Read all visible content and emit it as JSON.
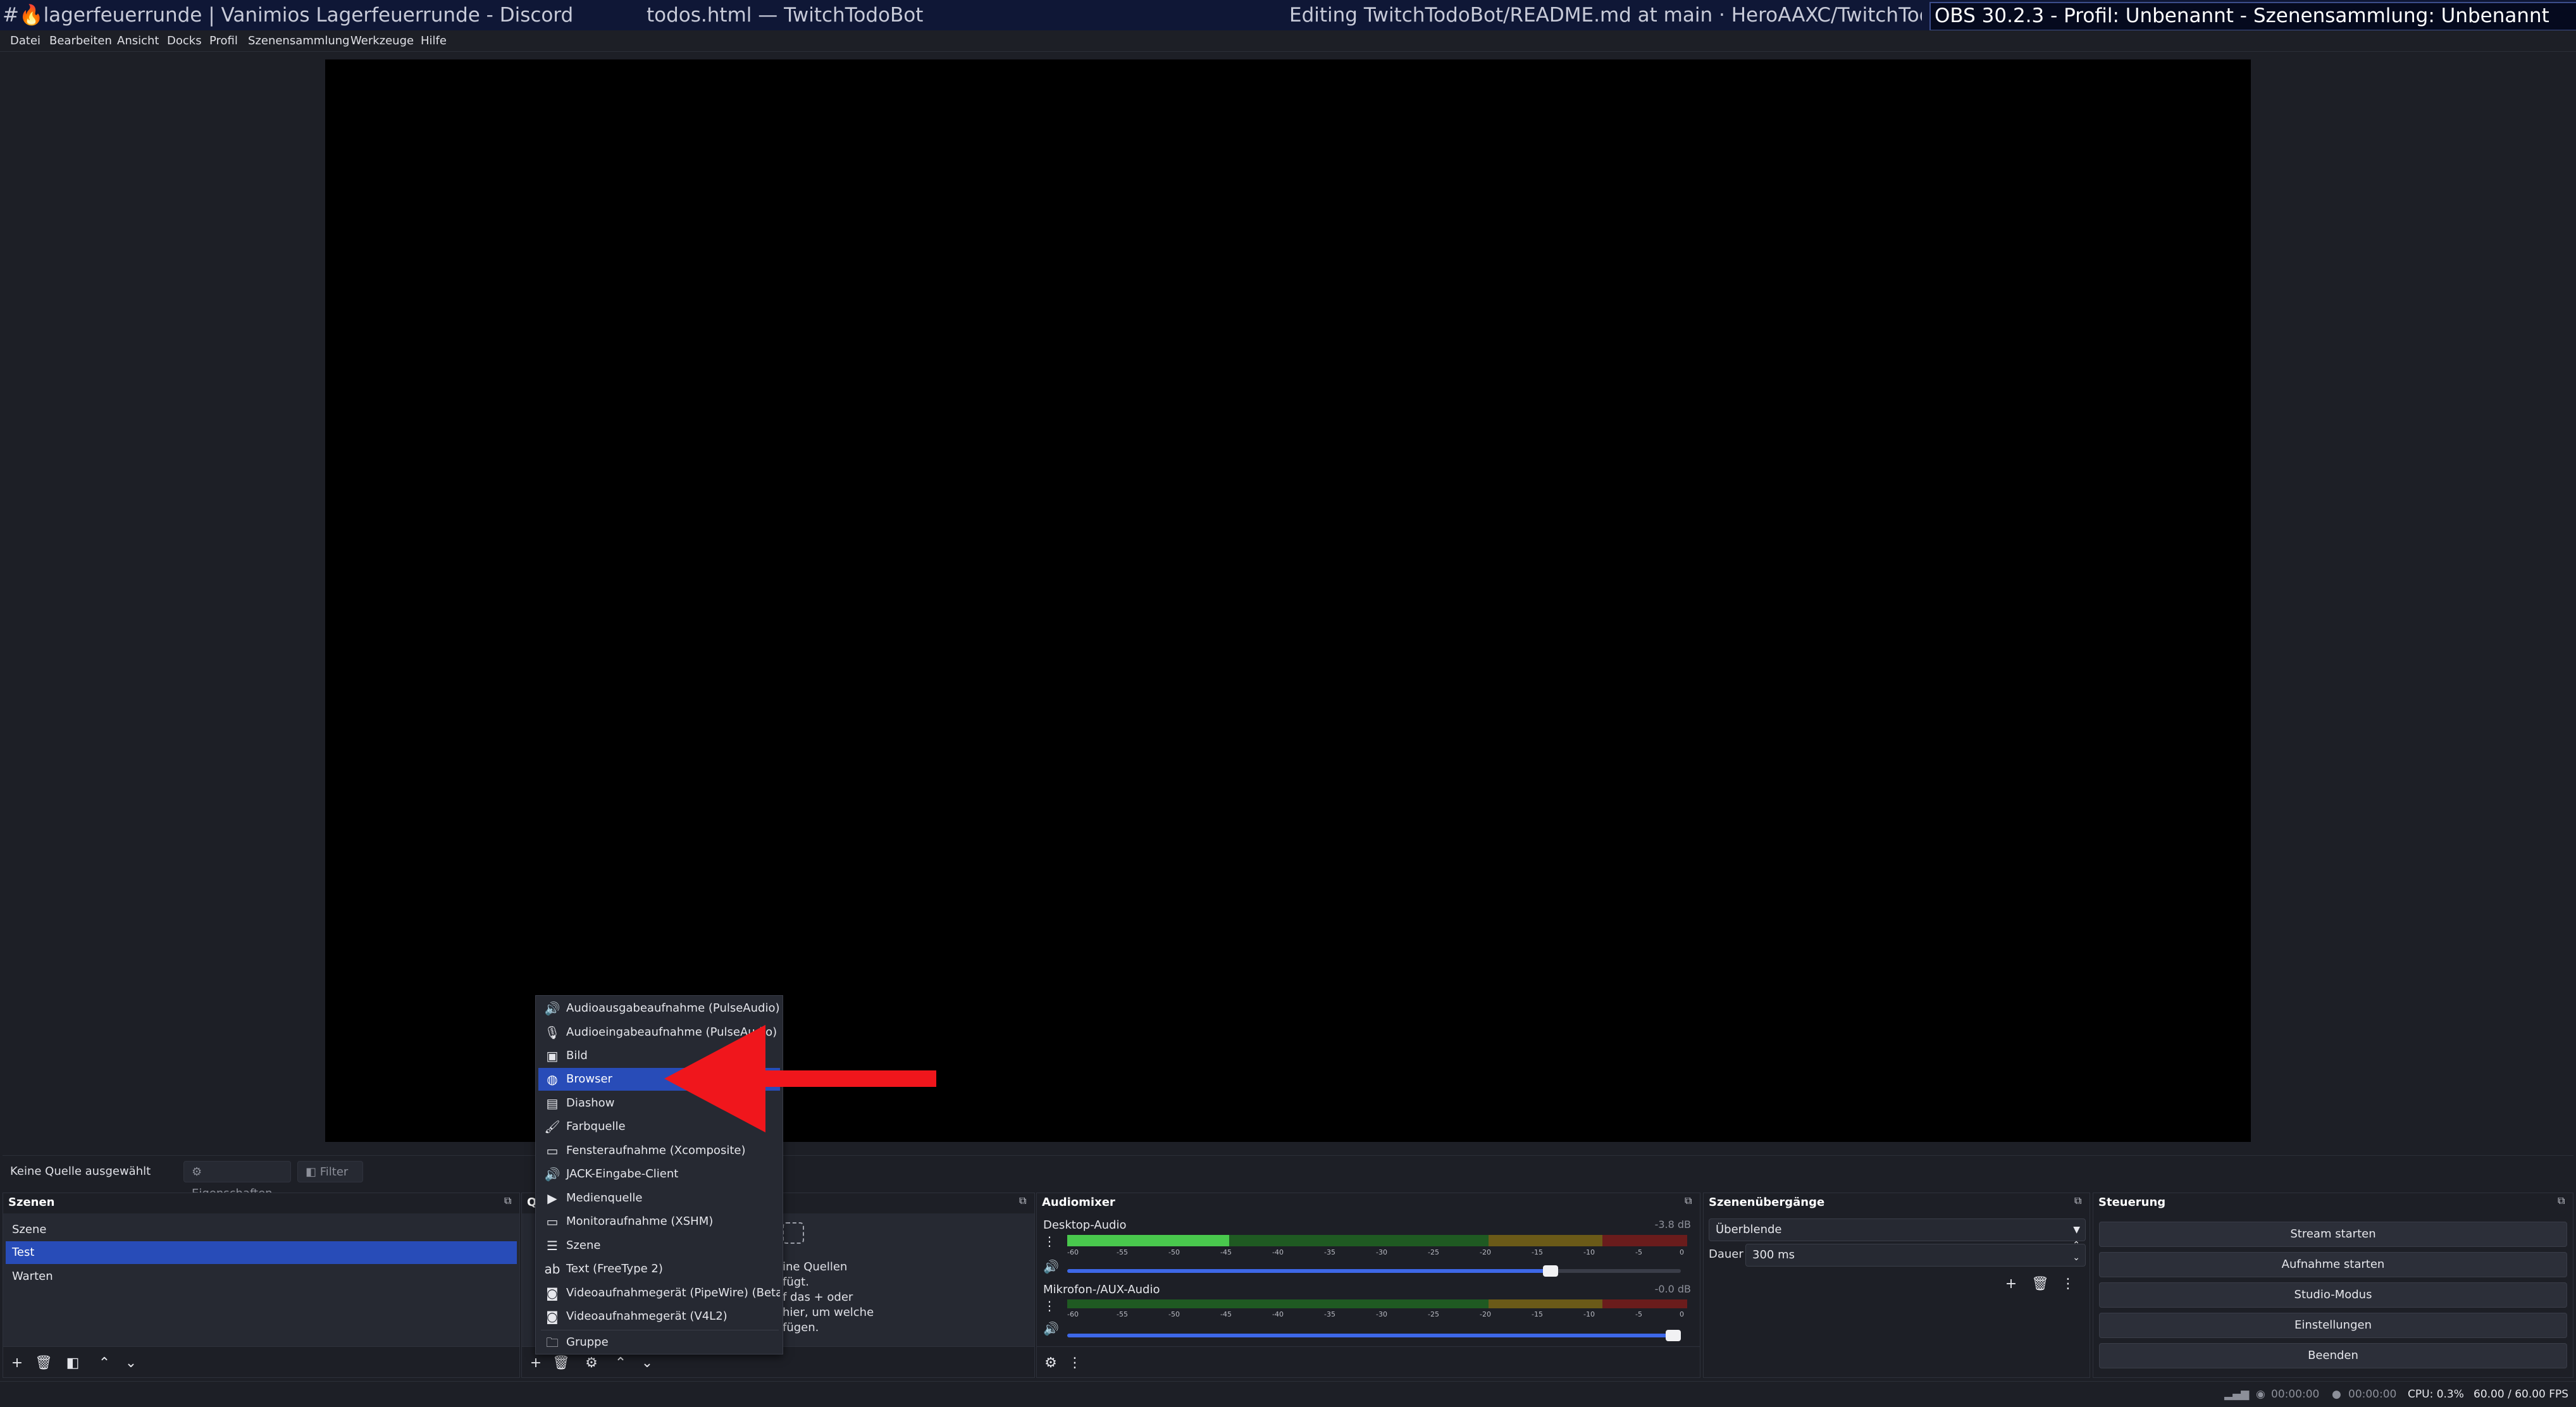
{
  "taskbar": {
    "windows": [
      {
        "title": "#🔥lagerfeuerrunde | Vanimios Lagerfeuerrunde - Discord"
      },
      {
        "title": "todos.html — TwitchTodoBot"
      },
      {
        "title": "Editing TwitchTodoBot/README.md at main · HeroAAXC/TwitchTodoBo..."
      },
      {
        "title": "OBS 30.2.3 - Profil: Unbenannt - Szenensammlung: Unbenannt"
      }
    ]
  },
  "menubar": [
    "Datei",
    "Bearbeiten",
    "Ansicht",
    "Docks",
    "Profil",
    "Szenensammlung",
    "Werkzeuge",
    "Hilfe"
  ],
  "source_toolbar": {
    "no_source": "Keine Quelle ausgewählt",
    "properties": "Eigenschaften",
    "filters": "Filter"
  },
  "scenes": {
    "title": "Szenen",
    "items": [
      "Szene",
      "Test",
      "Warten"
    ],
    "selected": "Test"
  },
  "sources": {
    "title": "Q",
    "hint_lines": [
      "ine Quellen",
      "fügt.",
      "f das + oder",
      "hier, um welche",
      "fügen."
    ]
  },
  "context_menu": {
    "items": [
      {
        "label": "Audioausgabeaufnahme (PulseAudio)",
        "icon": "speaker-icon"
      },
      {
        "label": "Audioeingabeaufnahme (PulseAudio)",
        "icon": "microphone-icon"
      },
      {
        "label": "Bild",
        "icon": "image-icon"
      },
      {
        "label": "Browser",
        "icon": "globe-icon"
      },
      {
        "label": "Diashow",
        "icon": "slideshow-icon"
      },
      {
        "label": "Farbquelle",
        "icon": "paintbrush-icon"
      },
      {
        "label": "Fensteraufnahme (Xcomposite)",
        "icon": "window-icon"
      },
      {
        "label": "JACK-Eingabe-Client",
        "icon": "speaker-icon"
      },
      {
        "label": "Medienquelle",
        "icon": "play-icon"
      },
      {
        "label": "Monitoraufnahme (XSHM)",
        "icon": "monitor-icon"
      },
      {
        "label": "Szene",
        "icon": "list-icon"
      },
      {
        "label": "Text (FreeType 2)",
        "icon": "text-icon"
      },
      {
        "label": "Videoaufnahmegerät (PipeWire) (Beta)",
        "icon": "camera-icon"
      },
      {
        "label": "Videoaufnahmegerät (V4L2)",
        "icon": "camera-icon"
      },
      {
        "label": "Gruppe",
        "icon": "folder-icon"
      }
    ],
    "highlighted": "Browser"
  },
  "mixer": {
    "title": "Audiomixer",
    "ticks": [
      "-60",
      "-55",
      "-50",
      "-45",
      "-40",
      "-35",
      "-30",
      "-25",
      "-20",
      "-15",
      "-10",
      "-5",
      "0"
    ],
    "channels": [
      {
        "name": "Desktop-Audio",
        "db": "-3.8 dB",
        "volume": 0.8
      },
      {
        "name": "Mikrofon-/AUX-Audio",
        "db": "-0.0 dB",
        "volume": 1.0
      }
    ]
  },
  "transitions": {
    "title": "Szenenübergänge",
    "selected": "Überblende",
    "duration_label": "Dauer",
    "duration_value": "300 ms"
  },
  "controls": {
    "title": "Steuerung",
    "buttons": [
      "Stream starten",
      "Aufnahme starten",
      "Studio-Modus",
      "Einstellungen",
      "Beenden"
    ]
  },
  "statusbar": {
    "stream_time": "00:00:00",
    "rec_time": "00:00:00",
    "cpu": "CPU: 0.3%",
    "fps": "60.00 / 60.00 FPS"
  },
  "colors": {
    "accent": "#284cb8",
    "arrow": "#f0161c"
  }
}
